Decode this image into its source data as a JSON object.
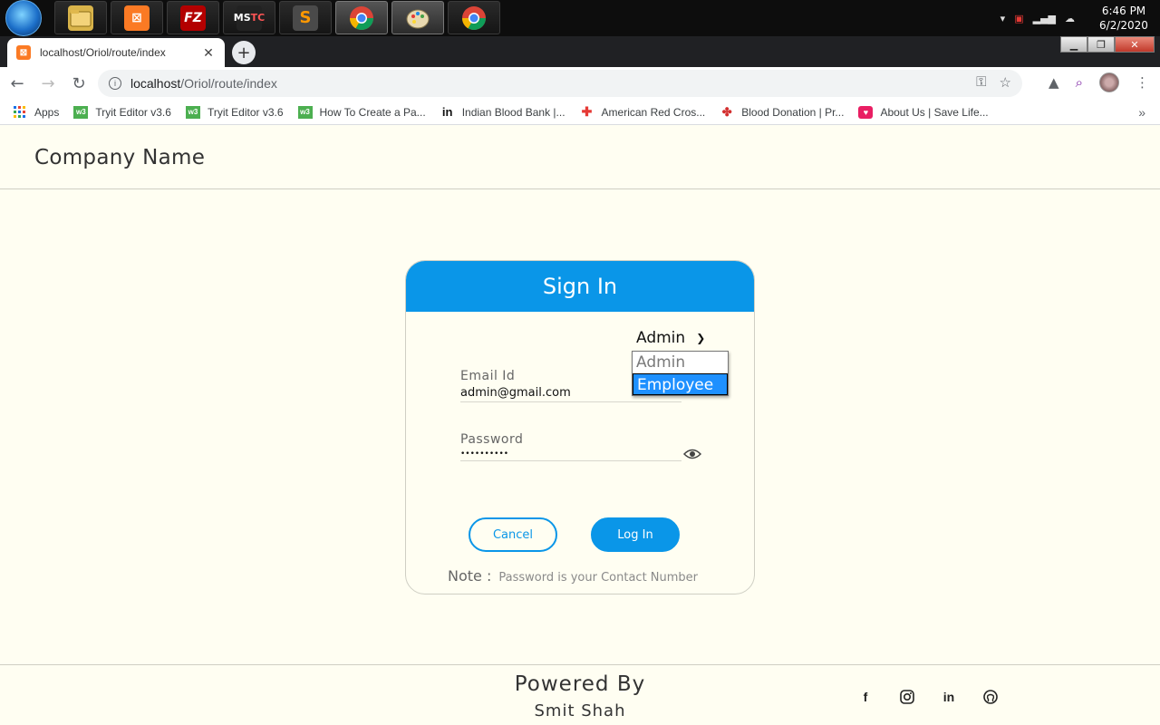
{
  "taskbar": {
    "clock_time": "6:46 PM",
    "clock_date": "6/2/2020",
    "apps": [
      {
        "name": "file-explorer",
        "glyph": "",
        "color": "#d9b44a"
      },
      {
        "name": "xampp",
        "glyph": "⊠",
        "color": "#fb7a24"
      },
      {
        "name": "filezilla",
        "glyph": "FZ",
        "color": "#b30000"
      },
      {
        "name": "ms-office",
        "glyph": "MS",
        "color": "#222222"
      },
      {
        "name": "sublime-text",
        "glyph": "S",
        "color": "#4a4a4a"
      },
      {
        "name": "chrome",
        "glyph": "",
        "color": "#db4437"
      },
      {
        "name": "paint",
        "glyph": "",
        "color": "#7aa7d9"
      },
      {
        "name": "chrome-2",
        "glyph": "",
        "color": "#db4437"
      }
    ]
  },
  "browser": {
    "tab_title": "localhost/Oriol/route/index",
    "url_host": "localhost",
    "url_path": "/Oriol/route/index",
    "bookmarks": [
      {
        "label": "Apps",
        "icon": "apps-grid-icon",
        "color": "#1a73e8"
      },
      {
        "label": "Tryit Editor v3.6",
        "icon": "w3-icon",
        "color": "#4caf50"
      },
      {
        "label": "Tryit Editor v3.6",
        "icon": "w3-icon",
        "color": "#4caf50"
      },
      {
        "label": "How To Create a Pa...",
        "icon": "w3-icon",
        "color": "#4caf50"
      },
      {
        "label": "Indian Blood Bank |...",
        "icon": "in-icon",
        "color": "#111111"
      },
      {
        "label": "American Red Cros...",
        "icon": "red-cross-icon",
        "color": "#e53935"
      },
      {
        "label": "Blood Donation | Pr...",
        "icon": "blood-drop-icon",
        "color": "#d32f2f"
      },
      {
        "label": "About Us | Save Life...",
        "icon": "heart-icon",
        "color": "#e91e63"
      }
    ]
  },
  "page": {
    "company_name": "Company Name",
    "card": {
      "title": "Sign In",
      "role_selected": "Admin",
      "role_options": [
        "Admin",
        "Employee"
      ],
      "email_label": "Email Id",
      "email_value": "admin@gmail.com",
      "password_label": "Password",
      "password_value": "••••••••••",
      "cancel_label": "Cancel",
      "login_label": "Log In",
      "note_label": "Note :",
      "note_text": "Password is your Contact Number"
    },
    "footer": {
      "powered_by": "Powered By",
      "author": "Smit Shah",
      "socials": [
        "facebook",
        "instagram",
        "linkedin",
        "github"
      ]
    }
  },
  "colors": {
    "accent": "#0a96e8",
    "page_bg": "#fffef2",
    "dropdown_highlight": "#1e90ff"
  }
}
